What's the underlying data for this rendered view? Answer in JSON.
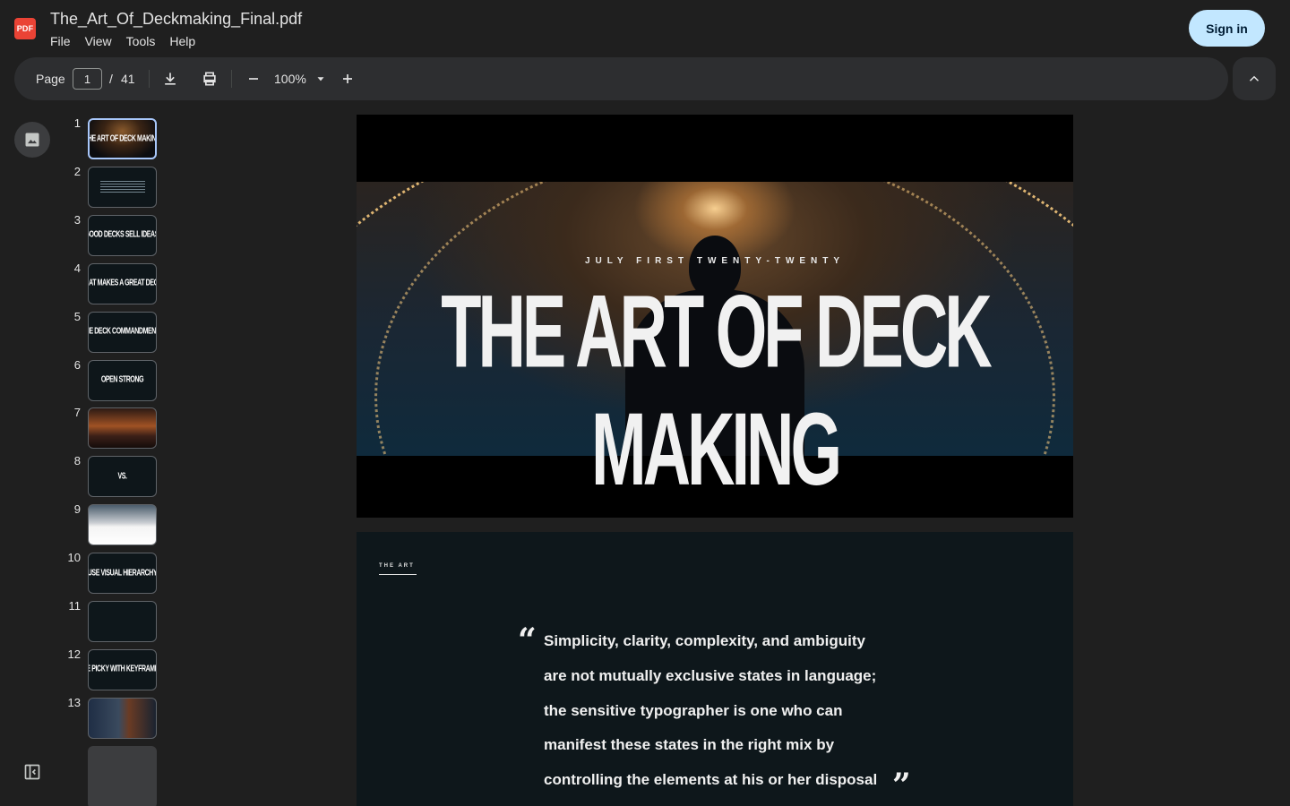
{
  "app": {
    "logo_text": "PDF",
    "doc_title": "The_Art_Of_Deckmaking_Final.pdf",
    "menu": [
      "File",
      "View",
      "Tools",
      "Help"
    ],
    "sign_in_label": "Sign in"
  },
  "toolbar": {
    "page_label": "Page",
    "current_page": "1",
    "separator": "/",
    "total_pages": "41",
    "zoom": "100%"
  },
  "thumbnails": [
    {
      "num": "1",
      "text": "THE ART OF DECK MAKING",
      "style": "photo-1",
      "selected": true
    },
    {
      "num": "2",
      "text": "",
      "style": "lines"
    },
    {
      "num": "3",
      "text": "GOOD DECKS SELL IDEAS.",
      "style": "dark"
    },
    {
      "num": "4",
      "text": "WHAT MAKES A GREAT DECK?",
      "style": "dark"
    },
    {
      "num": "5",
      "text": "THE DECK COMMANDMENTS",
      "style": "dark"
    },
    {
      "num": "6",
      "text": "OPEN STRONG",
      "style": "dark"
    },
    {
      "num": "7",
      "text": "",
      "style": "photo-7"
    },
    {
      "num": "8",
      "text": "VS.",
      "style": "dark"
    },
    {
      "num": "9",
      "text": "",
      "style": "photo-9"
    },
    {
      "num": "10",
      "text": "USE VISUAL HIERARCHY",
      "style": "dark"
    },
    {
      "num": "11",
      "text": "",
      "style": "photo-11"
    },
    {
      "num": "12",
      "text": "BE PICKY WITH KEYFRAMES",
      "style": "dark"
    },
    {
      "num": "13",
      "text": "",
      "style": "photo-13"
    },
    {
      "num": "",
      "text": "",
      "style": "placeholder"
    }
  ],
  "page1": {
    "date_line": "JULY FIRST TWENTY-TWENTY",
    "title": "THE ART OF DECK MAKING"
  },
  "page2": {
    "tag": "THE ART",
    "quote_open": "“",
    "quote_close": "”",
    "quote_lines": [
      "Simplicity, clarity, complexity, and ambiguity",
      "are not mutually exclusive states in language;",
      "the sensitive typographer is one who can",
      "manifest these states in the right mix by",
      "controlling the elements at his or her disposal"
    ]
  },
  "icons": {
    "download": "download-icon",
    "print": "print-icon",
    "zoom_out": "minus-icon",
    "zoom_in": "plus-icon",
    "zoom_dropdown": "caret-down-icon",
    "collapse": "chevron-up-icon",
    "thumbnails": "image-icon",
    "sidebar": "sidebar-toggle-icon"
  },
  "colors": {
    "background": "#1f1f1f",
    "toolbar": "#2d2e30",
    "sign_in_bg": "#c2e7ff",
    "selected_thumb": "#a8c7fa",
    "logo": "#ea4335"
  }
}
